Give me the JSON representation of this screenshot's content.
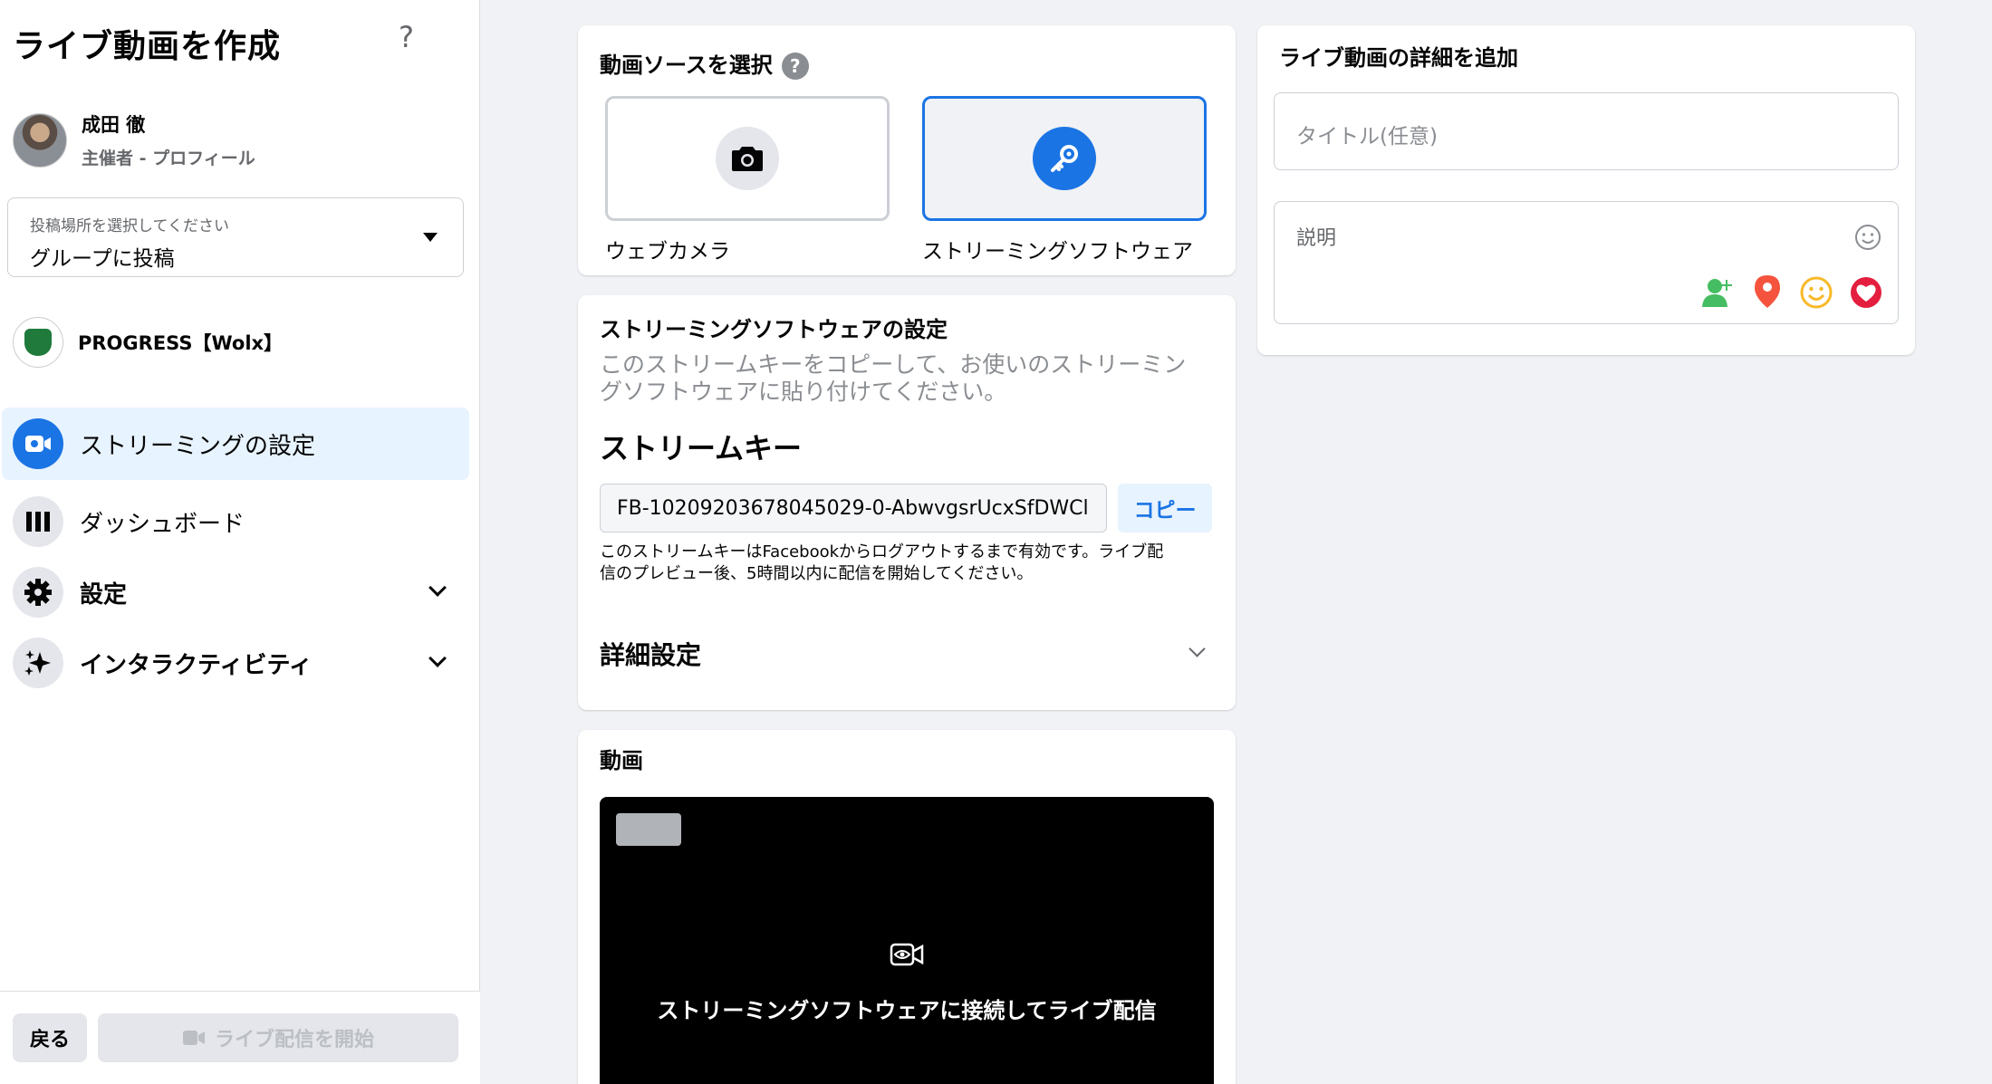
{
  "sidebar": {
    "title": "ライブ動画を作成",
    "help": "?",
    "profile": {
      "name": "成田 徹",
      "role": "主催者 - プロフィール"
    },
    "post_location": {
      "label": "投稿場所を選択してください",
      "value": "グループに投稿"
    },
    "group": {
      "name": "PROGRESS【Wolx】"
    },
    "nav": [
      {
        "label": "ストリーミングの設定"
      },
      {
        "label": "ダッシュボード"
      },
      {
        "label": "設定"
      },
      {
        "label": "インタラクティビティ"
      }
    ],
    "footer": {
      "back_label": "戻る",
      "go_live_label": "ライブ配信を開始"
    }
  },
  "source": {
    "title": "動画ソースを選択",
    "help": "?",
    "options": [
      {
        "label": "ウェブカメラ"
      },
      {
        "label": "ストリーミングソフトウェア"
      }
    ]
  },
  "streaming": {
    "title": "ストリーミングソフトウェアの設定",
    "instructions_line1": "このストリームキーをコピーして、お使いのストリーミン",
    "instructions_line2": "グソフトウェアに貼り付けてください。",
    "key_heading": "ストリームキー",
    "key_value": "FB-10209203678045029-0-AbwvgsrUcxSfDWCl",
    "copy_label": "コピー",
    "note_line1": "このストリームキーはFacebookからログアウトするまで有効です。ライブ配",
    "note_line2": "信のプレビュー後、5時間以内に配信を開始してください。",
    "advanced_label": "詳細設定"
  },
  "video": {
    "title": "動画",
    "connect_text": "ストリーミングソフトウェアに接続してライブ配信"
  },
  "details": {
    "title": "ライブ動画の詳細を追加",
    "title_placeholder": "タイトル(任意)",
    "description_placeholder": "説明"
  },
  "colors": {
    "accent": "#1b74e4",
    "background": "#f0f2f5"
  }
}
